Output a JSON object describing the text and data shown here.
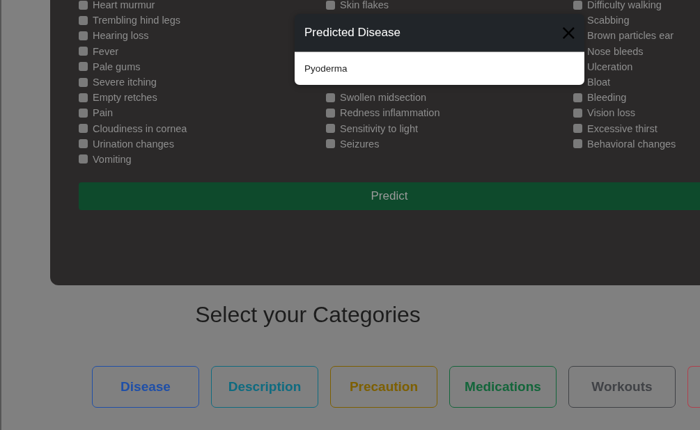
{
  "symptom_columns": [
    {
      "items": [
        {
          "label": "Heart murmur",
          "checked": false
        },
        {
          "label": "Trembling hind legs",
          "checked": false
        },
        {
          "label": "Hearing loss",
          "checked": false
        },
        {
          "label": "Fever",
          "checked": false
        },
        {
          "label": "Pale gums",
          "checked": false
        },
        {
          "label": "Severe itching",
          "checked": false
        },
        {
          "label": "Empty retches",
          "checked": false
        },
        {
          "label": "Pain",
          "checked": false
        },
        {
          "label": "Cloudiness in cornea",
          "checked": false
        },
        {
          "label": "Urination changes",
          "checked": false
        },
        {
          "label": "Vomiting",
          "checked": false
        }
      ]
    },
    {
      "items": [
        {
          "label": "Skin flakes",
          "checked": false
        },
        {
          "label": "Swollen midsection",
          "checked": false
        },
        {
          "label": "Redness inflammation",
          "checked": false
        },
        {
          "label": "Sensitivity to light",
          "checked": false
        },
        {
          "label": "Seizures",
          "checked": false
        }
      ]
    },
    {
      "items": [
        {
          "label": "Difficulty walking",
          "checked": false
        },
        {
          "label": "Scabbing"
        },
        {
          "label": "Brown particles ear"
        },
        {
          "label": "Nose bleeds"
        },
        {
          "label": "Ulceration"
        },
        {
          "label": "Bloat"
        },
        {
          "label": "Bleeding",
          "checked": false
        },
        {
          "label": "Vision loss",
          "checked": false
        },
        {
          "label": "Excessive thirst",
          "checked": false
        },
        {
          "label": "Behavioral changes",
          "checked": false
        }
      ]
    }
  ],
  "predict_button": "Predict",
  "modal": {
    "title": "Predicted Disease",
    "close": "×",
    "result": "Pyoderma"
  },
  "categories": {
    "heading": "Select your Categories",
    "buttons": [
      {
        "label": "Disease",
        "color": "#1f4fa8"
      },
      {
        "label": "Description",
        "color": "#0f6b80"
      },
      {
        "label": "Precaution",
        "color": "#7d5f00"
      },
      {
        "label": "Medications",
        "color": "#13653a"
      },
      {
        "label": "Workouts",
        "color": "#404246"
      },
      {
        "color": "#b0404c"
      }
    ]
  }
}
